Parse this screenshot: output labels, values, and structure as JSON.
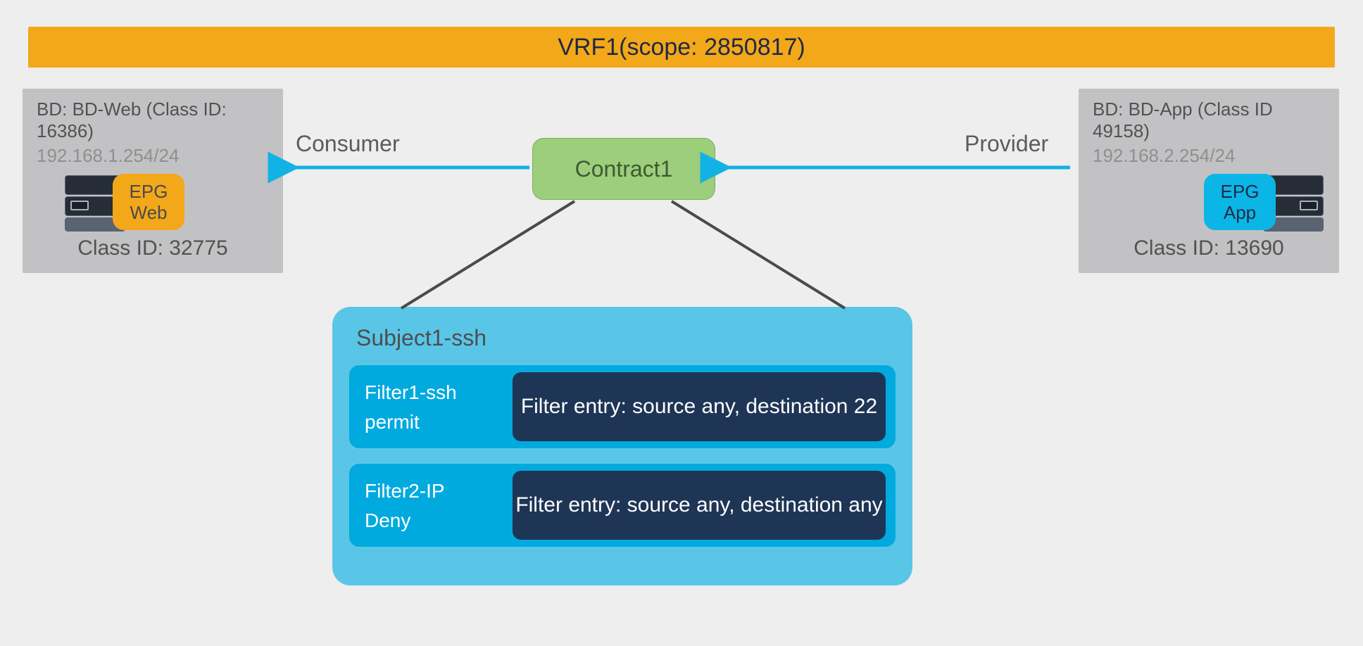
{
  "vrf": {
    "label": "VRF1(scope: 2850817)"
  },
  "left_bd": {
    "header": "BD: BD-Web (Class ID: 16386)",
    "ip": "192.168.1.254/24",
    "epg_line1": "EPG",
    "epg_line2": "Web",
    "class_id": "Class ID: 32775"
  },
  "right_bd": {
    "header": "BD: BD-App (Class ID 49158)",
    "ip": "192.168.2.254/24",
    "epg_line1": "EPG",
    "epg_line2": "App",
    "class_id": "Class ID: 13690"
  },
  "contract": {
    "label": "Contract1"
  },
  "relations": {
    "consumer": "Consumer",
    "provider": "Provider"
  },
  "subject": {
    "title": "Subject1-ssh",
    "filters": [
      {
        "name": "Filter1-ssh",
        "action": "permit",
        "entry": "Filter entry: source any, destination 22"
      },
      {
        "name": "Filter2-IP",
        "action": "Deny",
        "entry": "Filter entry: source any, destination any"
      }
    ]
  }
}
